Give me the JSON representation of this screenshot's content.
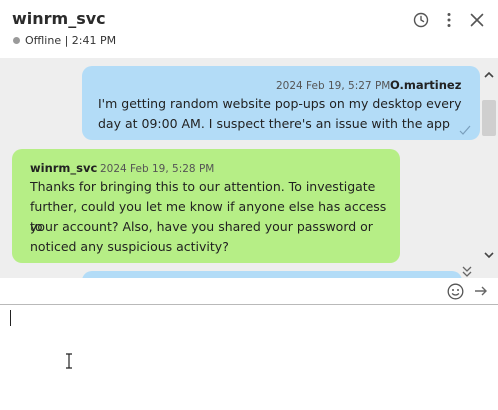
{
  "header": {
    "title": "winrm_svc",
    "status": "Offline | 2:41 PM",
    "icons": [
      "history-icon",
      "more-icon",
      "close-icon"
    ]
  },
  "messages": [
    {
      "direction": "outgoing",
      "timestamp": "2024 Feb 19, 5:27 PM",
      "sender": "O.martinez",
      "lines": [
        "I'm getting random website pop-ups on my desktop every",
        "day at 09:00 AM. I suspect there's an issue with the app"
      ]
    },
    {
      "direction": "incoming",
      "sender": "winrm_svc",
      "timestamp": "2024 Feb 19, 5:28 PM",
      "lines": [
        "Thanks for bringing this to our attention. To investigate",
        "further, could you let me know if anyone else has access to",
        "your account? Also, have you shared your password or",
        "noticed any suspicious activity?"
      ]
    }
  ],
  "composer": {
    "value": "",
    "placeholder": ""
  },
  "colors": {
    "outgoing_bubble": "#b3dcf7",
    "incoming_bubble": "#b6ee86",
    "chat_background": "#eeeeee",
    "offline_dot": "#9a9a9a"
  }
}
